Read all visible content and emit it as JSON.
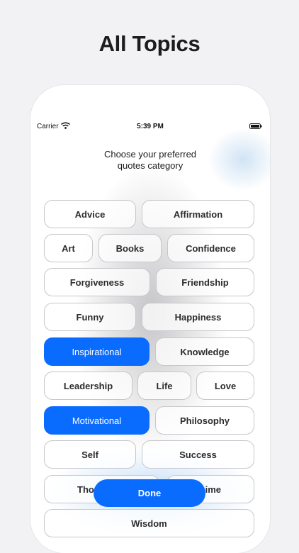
{
  "headline": "All Topics",
  "status_bar": {
    "carrier": "Carrier",
    "time": "5:39 PM"
  },
  "prompt": {
    "line1": "Choose your preferred",
    "line2": "quotes category"
  },
  "topics": {
    "advice": "Advice",
    "affirmation": "Affirmation",
    "art": "Art",
    "books": "Books",
    "confidence": "Confidence",
    "forgiveness": "Forgiveness",
    "friendship": "Friendship",
    "funny": "Funny",
    "happiness": "Happiness",
    "inspirational": "Inspirational",
    "knowledge": "Knowledge",
    "leadership": "Leadership",
    "life": "Life",
    "love": "Love",
    "motivational": "Motivational",
    "philosophy": "Philosophy",
    "self": "Self",
    "success": "Success",
    "thoughts_partial": "Tho",
    "time_partial": "ime",
    "wisdom": "Wisdom"
  },
  "selected_topics": [
    "Inspirational",
    "Motivational"
  ],
  "done_label": "Done",
  "colors": {
    "accent": "#0a6cff",
    "chip_border": "#c7c7cc",
    "text": "#1c1c1e"
  },
  "icons": [
    "wifi-icon",
    "battery-icon"
  ]
}
